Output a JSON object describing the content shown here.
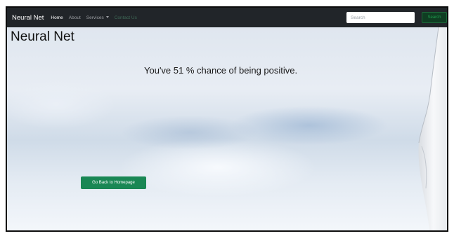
{
  "navbar": {
    "brand": "Neural Net",
    "links": [
      {
        "label": "Home"
      },
      {
        "label": "About"
      },
      {
        "label": "Services"
      },
      {
        "label": "Contact Us"
      }
    ],
    "search": {
      "placeholder": "Search",
      "value": "",
      "button_label": "Search"
    }
  },
  "main": {
    "title": "Neural Net",
    "result_text": "You've 51 % chance of being positive.",
    "back_button_label": "Go Back to Homepage"
  },
  "colors": {
    "navbar_bg": "#212529",
    "button_green": "#198754"
  },
  "icons": {
    "services_dropdown": "caret-down-icon"
  }
}
